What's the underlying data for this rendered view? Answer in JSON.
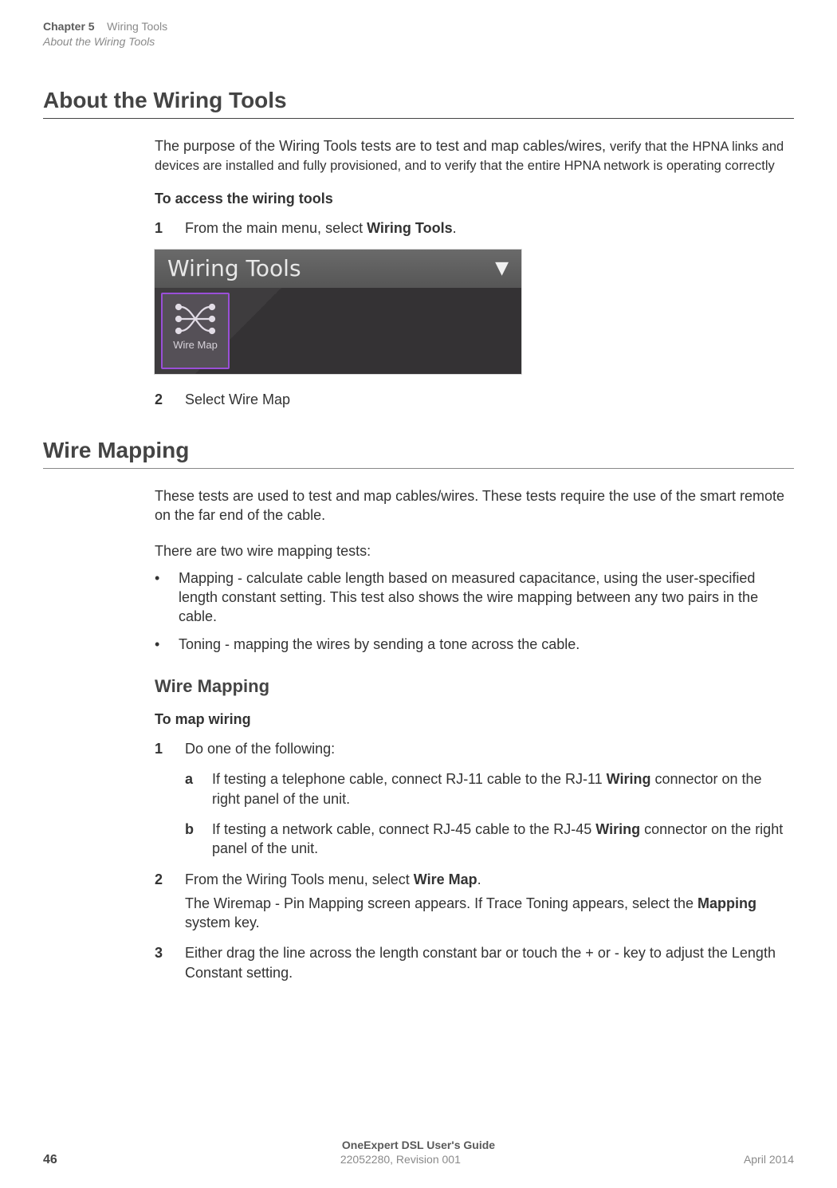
{
  "running_head": {
    "chapter": "Chapter 5",
    "chapter_title": "Wiring Tools",
    "section": "About the Wiring Tools"
  },
  "h1": "About the Wiring Tools",
  "intro_a": "The purpose of the Wiring Tools tests are to test and map cables/wires, ",
  "intro_b": "verify that the HPNA links and devices are installed and fully provisioned, and to verify that the entire HPNA network is operating correctly",
  "subhead_access": "To access the wiring tools",
  "steps_access": [
    {
      "num": "1",
      "body_a": "From the main menu, select ",
      "body_b": "Wiring Tools",
      "body_c": "."
    },
    {
      "num": "2",
      "body_a": "Select Wire Map",
      "body_b": "",
      "body_c": ""
    }
  ],
  "widget": {
    "title": "Wiring Tools",
    "tool_label": "Wire Map"
  },
  "h1b": "Wire Mapping",
  "wm_intro": " These tests are used to test and map cables/wires. These tests require the use of the smart remote on the far end of the cable.",
  "wm_two": "There are two wire mapping tests:",
  "wm_bullets": [
    "Mapping - calculate cable length based on measured capacitance, using the user-specified length constant setting. This test also shows the wire mapping between any two pairs in the cable.",
    "Toning - mapping the wires by sending a tone across the cable."
  ],
  "h2_wm": "Wire Mapping",
  "subhead_map": "To map wiring",
  "map_step1": {
    "num": "1",
    "body": "Do one of the following:"
  },
  "map_sub_a": {
    "letter": "a",
    "pre": "If testing a telephone cable, connect RJ-11 cable to the RJ-11 ",
    "bold": "Wiring",
    "post": " connector on the right panel of the unit."
  },
  "map_sub_b": {
    "letter": "b",
    "pre": "If testing a network cable, connect RJ-45 cable to the RJ-45 ",
    "bold": "Wiring",
    "post": " connector on the right panel of the unit."
  },
  "map_step2": {
    "num": "2",
    "pre": "From the Wiring Tools menu, select ",
    "bold": "Wire Map",
    "post": ".",
    "line2_pre": "The Wiremap - Pin Mapping screen appears. If Trace Toning appears, select the ",
    "line2_bold": "Mapping",
    "line2_post": " system key."
  },
  "map_step3": {
    "num": "3",
    "body": "Either drag the line across the length constant bar or touch the + or - key to adjust the Length Constant setting."
  },
  "footer": {
    "title": "OneExpert DSL User's Guide",
    "page": "46",
    "rev": "22052280, Revision 001",
    "date": "April 2014"
  }
}
